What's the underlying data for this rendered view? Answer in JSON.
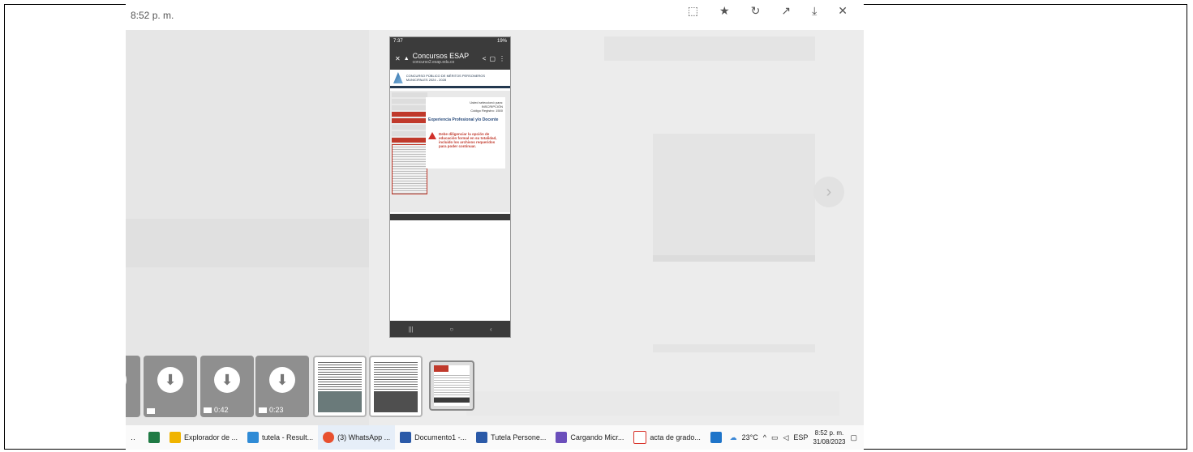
{
  "topbar": {
    "time": "8:52 p. m."
  },
  "phone": {
    "status_time": "7:37",
    "status_right": "19%",
    "app_title": "Concursos ESAP",
    "app_url": "concurso2.esap.edu.co",
    "banner": "CONCURSO PÚBLICO DE MÉRITOS PERSONEROS MUNICIPALES 2024 - 2028",
    "card_line1": "Usted seleccionó para:",
    "card_line2": "INSCRIPCIÓN",
    "card_line3": "Código Registro: 1500",
    "section": "Experiencia Profesional y/o Docente",
    "warning": "Debe diligenciar la opción de educación formal en su totalidad, incluido los archivos requeridos para poder continuar."
  },
  "thumbnails": [
    {
      "type": "video",
      "duration": ""
    },
    {
      "type": "video",
      "duration": "0:42"
    },
    {
      "type": "video",
      "duration": "0:23"
    }
  ],
  "taskbar": {
    "items": [
      {
        "label": "Explorador de ...",
        "color": "#f0b400"
      },
      {
        "label": "tutela - Result...",
        "color": "#2f8bd6"
      },
      {
        "label": "(3) WhatsApp ...",
        "color": "#e8502f"
      },
      {
        "label": "Documento1 -...",
        "color": "#2b5aa8"
      },
      {
        "label": "Tutela Persone...",
        "color": "#2b5aa8"
      },
      {
        "label": "Cargando Micr...",
        "color": "#6b4fbb"
      },
      {
        "label": "acta de grado...",
        "color": "#d9342b"
      }
    ],
    "weather": "23°C",
    "lang": "ESP",
    "clock_time": "8:52 p. m.",
    "clock_date": "31/08/2023"
  }
}
